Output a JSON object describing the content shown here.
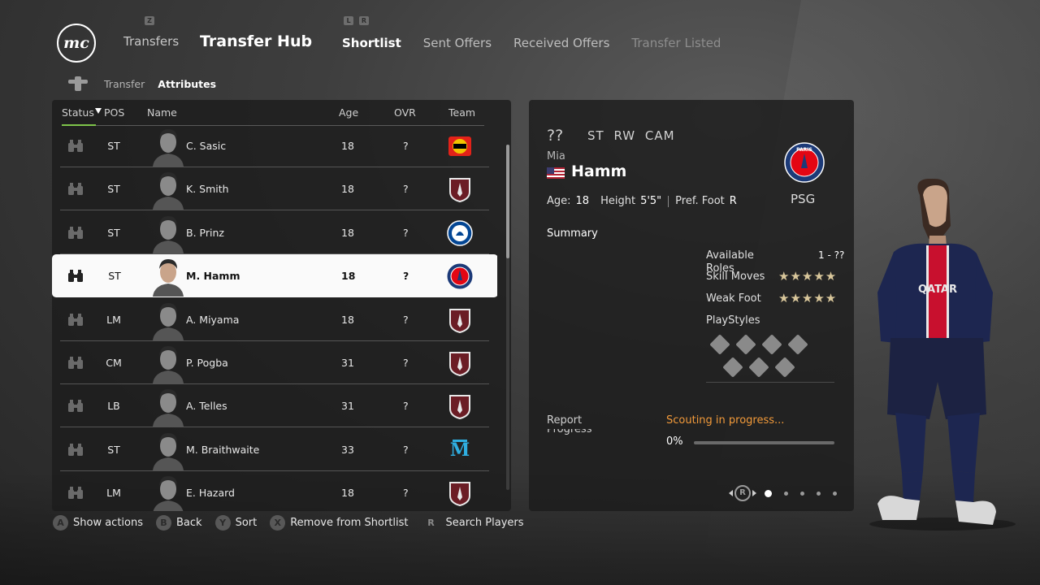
{
  "header": {
    "logo_text": "mc",
    "nav_left": "Transfers",
    "nav_left_badge": "Z",
    "page_title": "Transfer Hub",
    "tab_badges": [
      "L",
      "R"
    ],
    "tabs": [
      {
        "label": "Shortlist",
        "state": "active"
      },
      {
        "label": "Sent Offers",
        "state": "normal"
      },
      {
        "label": "Received Offers",
        "state": "normal"
      },
      {
        "label": "Transfer Listed",
        "state": "dim"
      }
    ]
  },
  "subnav": {
    "crumb1": "Transfer",
    "crumb2": "Attributes"
  },
  "table": {
    "headers": {
      "status": "Status",
      "pos": "POS",
      "name": "Name",
      "age": "Age",
      "ovr": "OVR",
      "team": "Team"
    },
    "rows": [
      {
        "pos": "ST",
        "name": "C. Sasic",
        "age": "18",
        "ovr": "?",
        "team_icon": "leverkusen-crest",
        "selected": false
      },
      {
        "pos": "ST",
        "name": "K. Smith",
        "age": "18",
        "ovr": "?",
        "team_icon": "generic-shield-crest",
        "selected": false
      },
      {
        "pos": "ST",
        "name": "B. Prinz",
        "age": "18",
        "ovr": "?",
        "team_icon": "chelsea-crest",
        "selected": false
      },
      {
        "pos": "ST",
        "name": "M. Hamm",
        "age": "18",
        "ovr": "?",
        "team_icon": "psg-crest",
        "selected": true
      },
      {
        "pos": "LM",
        "name": "A. Miyama",
        "age": "18",
        "ovr": "?",
        "team_icon": "generic-shield-crest",
        "selected": false
      },
      {
        "pos": "CM",
        "name": "P. Pogba",
        "age": "31",
        "ovr": "?",
        "team_icon": "generic-shield-crest",
        "selected": false
      },
      {
        "pos": "LB",
        "name": "A. Telles",
        "age": "31",
        "ovr": "?",
        "team_icon": "generic-shield-crest",
        "selected": false
      },
      {
        "pos": "ST",
        "name": "M. Braithwaite",
        "age": "33",
        "ovr": "?",
        "team_icon": "marseille-crest",
        "selected": false
      },
      {
        "pos": "LM",
        "name": "E. Hazard",
        "age": "18",
        "ovr": "?",
        "team_icon": "generic-shield-crest",
        "selected": false
      }
    ]
  },
  "detail": {
    "ovr": "??",
    "positions": "ST RW CAM",
    "first_name": "Mia",
    "last_name": "Hamm",
    "nationality_flag": "usa-flag",
    "club_name": "PSG",
    "club_crest_text": "PARIS",
    "age_label": "Age:",
    "age": "18",
    "height_label": "Height",
    "height": "5'5\"",
    "foot_label": "Pref. Foot",
    "foot": "R",
    "summary_label": "Summary",
    "available_roles_label": "Available Roles",
    "available_roles_value": "1 - ??",
    "skill_moves_label": "Skill Moves",
    "skill_moves_stars": "★★★★★",
    "weak_foot_label": "Weak Foot",
    "weak_foot_stars": "★★★★★",
    "playstyles_label": "PlayStyles",
    "report_status_label": "Report Status",
    "report_status_value": "Scouting in progress...",
    "progress_label": "Progress",
    "progress_value": "0%",
    "progress_fraction": 0,
    "pager_button": "R",
    "pages": 5,
    "active_page": 0
  },
  "footer": [
    {
      "button": "A",
      "label": "Show actions"
    },
    {
      "button": "B",
      "label": "Back"
    },
    {
      "button": "Y",
      "label": "Sort"
    },
    {
      "button": "X",
      "label": "Remove from Shortlist"
    },
    {
      "button": "R",
      "label": "Search Players"
    }
  ],
  "colors": {
    "accent_green": "#7ec44a",
    "progress_orange": "#f29a3a",
    "star_gold": "#d9c79b",
    "psg_blue": "#1c3a78"
  }
}
